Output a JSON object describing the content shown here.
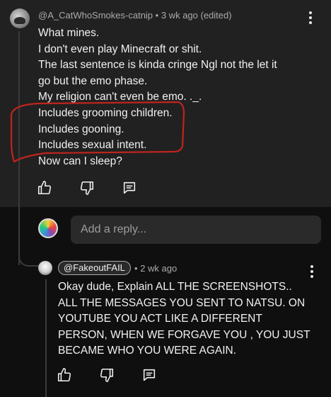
{
  "comment": {
    "handle": "@A_CatWhoSmokes-catnip",
    "separator": "•",
    "time": "3 wk ago (edited)",
    "lines": [
      "What mines.",
      "I don't even play Minecraft or shit.",
      "The last sentence is kinda cringe Ngl not the let it",
      "go but the emo phase.",
      "My religion can't even be emo. ._.",
      "Includes grooming children.",
      "Includes gooning.",
      "Includes sexual intent.",
      "Now can I sleep?"
    ]
  },
  "reply_box": {
    "placeholder": "Add a reply..."
  },
  "reply": {
    "mention": "@FakeoutFAIL",
    "separator": "•",
    "time": "2 wk ago",
    "lines": [
      "Okay dude, Explain ALL THE SCREENSHOTS..",
      "ALL THE MESSAGES YOU SENT TO NATSU. ON",
      "YOUTUBE YOU ACT LIKE A DIFFERENT",
      "PERSON, WHEN WE FORGAVE YOU , YOU JUST",
      "BECAME WHO YOU WERE AGAIN."
    ]
  },
  "icons": {
    "like": "thumbs-up-icon",
    "dislike": "thumbs-down-icon",
    "reply": "comment-icon",
    "more": "more-vertical-icon"
  },
  "colors": {
    "annotation": "#c0241e",
    "background_top": "#212121",
    "background_bottom": "#0f0f0f"
  }
}
